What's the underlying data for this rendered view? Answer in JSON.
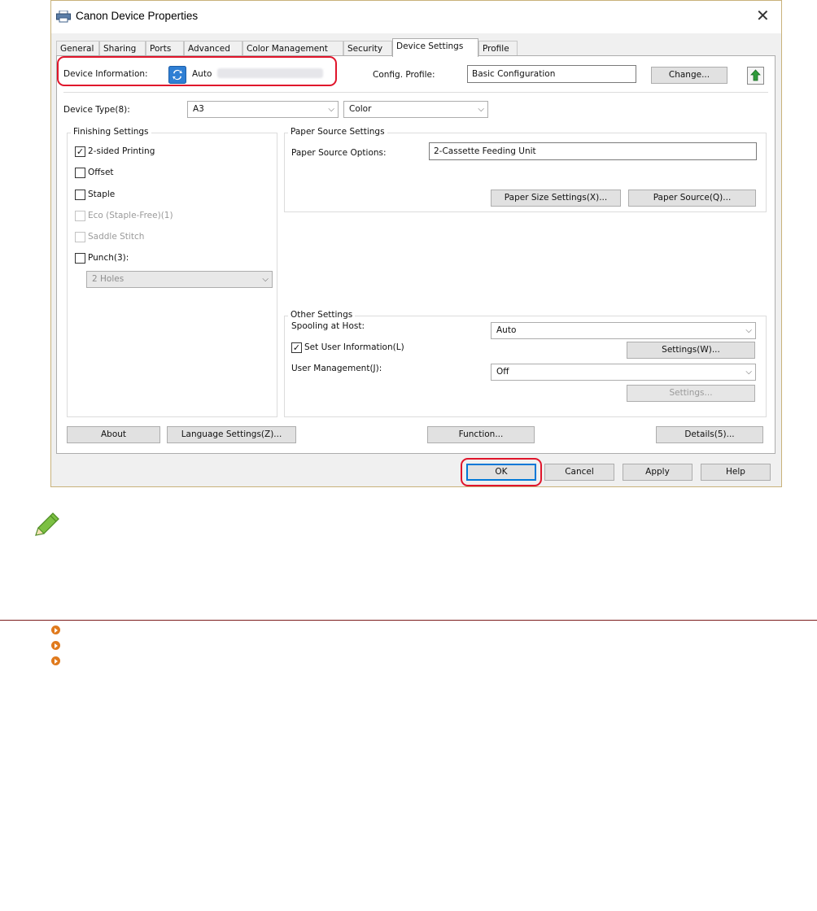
{
  "window": {
    "title": "Canon Device Properties"
  },
  "tabs": [
    {
      "label": "General"
    },
    {
      "label": "Sharing"
    },
    {
      "label": "Ports"
    },
    {
      "label": "Advanced"
    },
    {
      "label": "Color Management"
    },
    {
      "label": "Security"
    },
    {
      "label": "Device Settings"
    },
    {
      "label": "Profile"
    }
  ],
  "device_info": {
    "label": "Device Information:",
    "value": "Auto"
  },
  "config_profile": {
    "label": "Config. Profile:",
    "value": "Basic Configuration",
    "change_button": "Change..."
  },
  "device_type": {
    "label": "Device Type(8):",
    "size_value": "A3",
    "color_value": "Color"
  },
  "finishing": {
    "title": "Finishing Settings",
    "items": [
      {
        "label": "2-sided Printing",
        "checked": true,
        "enabled": true
      },
      {
        "label": "Offset",
        "checked": false,
        "enabled": true
      },
      {
        "label": "Staple",
        "checked": false,
        "enabled": true
      },
      {
        "label": "Eco (Staple-Free)(1)",
        "checked": false,
        "enabled": false
      },
      {
        "label": "Saddle Stitch",
        "checked": false,
        "enabled": false
      },
      {
        "label": "Punch(3):",
        "checked": false,
        "enabled": true
      }
    ],
    "punch_select": "2 Holes"
  },
  "paper_source": {
    "title": "Paper Source Settings",
    "options_label": "Paper Source Options:",
    "options_value": "2-Cassette Feeding Unit",
    "size_button": "Paper Size Settings(X)...",
    "source_button": "Paper Source(Q)..."
  },
  "other": {
    "title": "Other Settings",
    "spooling_label": "Spooling at Host:",
    "spooling_value": "Auto",
    "set_user_label": "Set User Information(L)",
    "settings_button": "Settings(W)...",
    "user_mgmt_label": "User Management(J):",
    "user_mgmt_value": "Off",
    "settings2_button": "Settings..."
  },
  "panel_buttons": {
    "about": "About",
    "language": "Language Settings(Z)...",
    "function": "Function...",
    "details": "Details(5)..."
  },
  "dialog_buttons": {
    "ok": "OK",
    "cancel": "Cancel",
    "apply": "Apply",
    "help": "Help"
  },
  "colors": {
    "highlight": "#e0152b",
    "accent": "#0078d7",
    "link_icon": "#e07a1d",
    "rule": "#7b1a1a"
  }
}
